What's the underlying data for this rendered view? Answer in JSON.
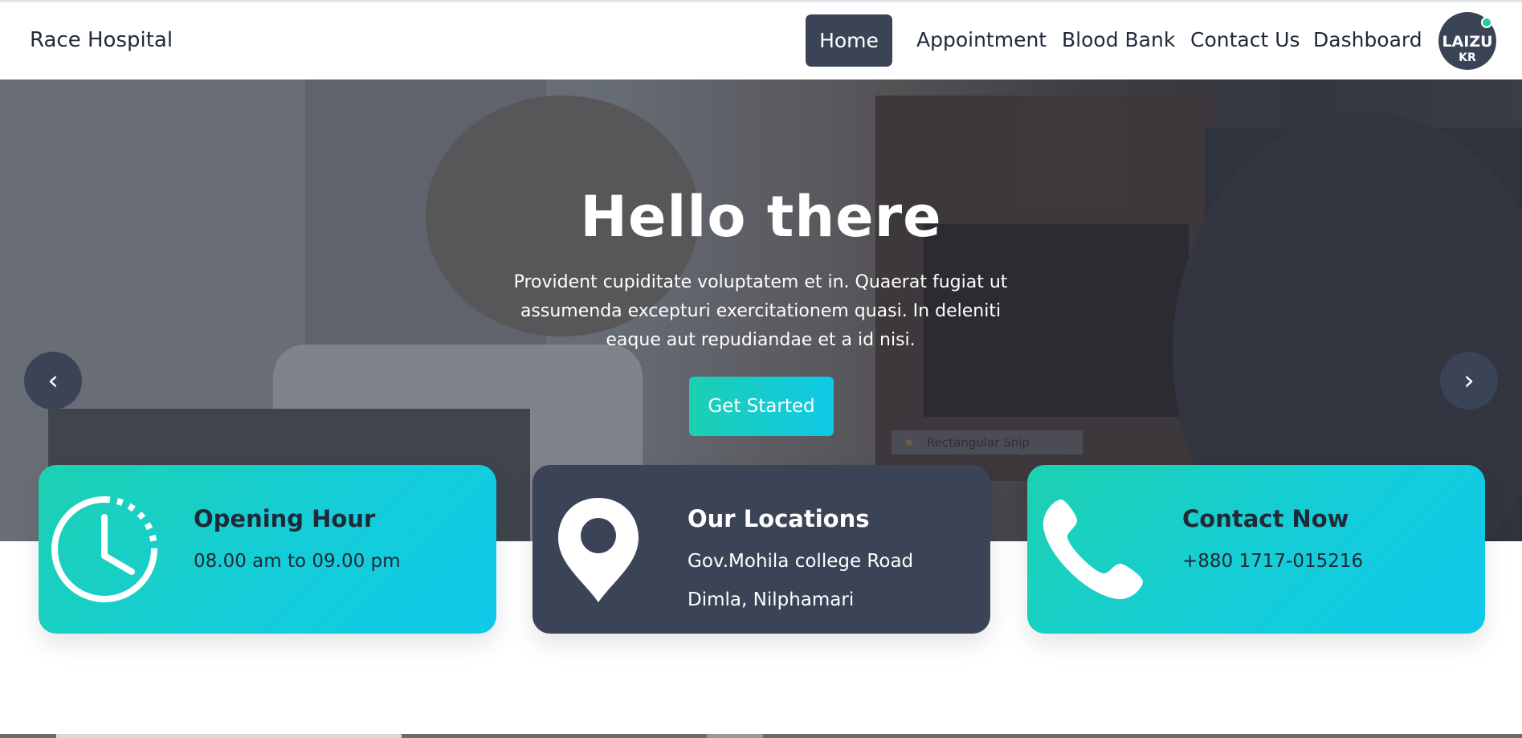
{
  "navbar": {
    "brand": "Race Hospital",
    "items": [
      {
        "label": "Home",
        "active": true
      },
      {
        "label": "Appointment"
      },
      {
        "label": "Blood Bank"
      },
      {
        "label": "Contact Us"
      },
      {
        "label": "Dashboard"
      }
    ],
    "avatar": {
      "initials": "LAIZU",
      "sub": "KR",
      "status_color": "#1fd29a"
    }
  },
  "hero": {
    "title": "Hello there",
    "text": "Provident cupiditate voluptatem et in. Quaerat fugiat ut assumenda excepturi exercitationem quasi. In deleniti eaque aut repudiandae et a id nisi.",
    "cta": "Get Started",
    "prev_icon": "‹",
    "next_icon": "›",
    "overlay_label": "Rectangular Snip"
  },
  "cards": [
    {
      "icon": "clock-icon",
      "title": "Opening Hour",
      "lines": [
        "08.00 am to 09.00 pm"
      ]
    },
    {
      "icon": "map-pin-icon",
      "title": "Our Locations",
      "lines": [
        "Gov.Mohila college Road",
        "Dimla, Nilphamari"
      ]
    },
    {
      "icon": "phone-icon",
      "title": "Contact Now",
      "lines": [
        "+880 1717-015216"
      ]
    }
  ],
  "colors": {
    "primary_dark": "#3b4357",
    "accent_teal": "#1dd1b1",
    "accent_cyan": "#10c9ea"
  }
}
